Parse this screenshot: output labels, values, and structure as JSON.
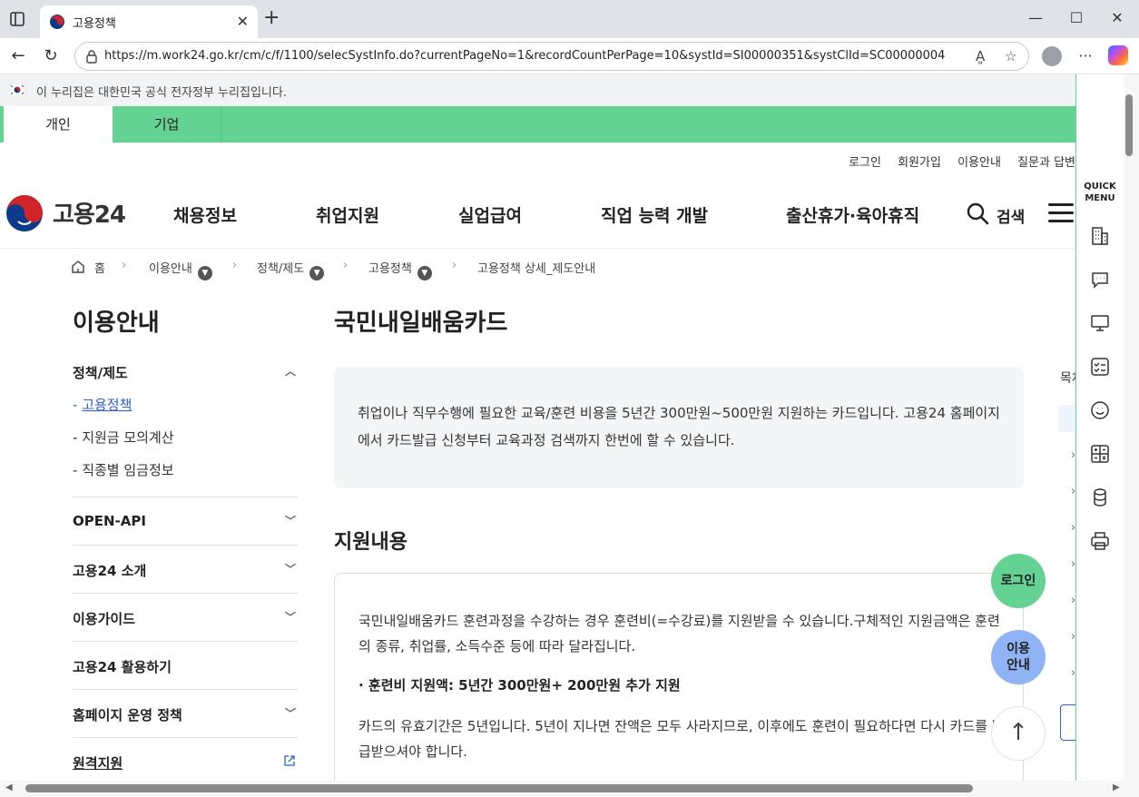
{
  "browser": {
    "tab_title": "고용정책",
    "url": "https://m.work24.go.kr/cm/c/f/1100/selecSystInfo.do?currentPageNo=1&recordCountPerPage=10&systId=SI00000351&systClId=SC00000004",
    "new_tab": "+",
    "minimize": "—",
    "maximize": "☐",
    "close": "✕"
  },
  "gov_banner": {
    "text": "이 누리집은 대한민국 공식 전자정부 누리집입니다."
  },
  "user_tabs": {
    "personal": "개인",
    "business": "기업"
  },
  "util_links": [
    "로그인",
    "회원가입",
    "이용안내",
    "질문과 답변"
  ],
  "logo": {
    "text": "고용24"
  },
  "gnb": [
    "채용정보",
    "취업지원",
    "실업급여",
    "직업 능력 개발",
    "출산휴가·육아휴직"
  ],
  "search_label": "검색",
  "breadcrumb": {
    "home": "홈",
    "level1": "이용안내",
    "level2": "정책/제도",
    "level3": "고용정책",
    "current": "고용정책 상세_제도안내"
  },
  "sidebar": {
    "title": "이용안내",
    "sections": [
      {
        "label": "정책/제도",
        "arrow": "︿"
      },
      {
        "label": "OPEN-API",
        "arrow": "﹀"
      },
      {
        "label": "고용24 소개",
        "arrow": "﹀"
      },
      {
        "label": "이용가이드",
        "arrow": "﹀"
      },
      {
        "label": "고용24 활용하기",
        "arrow": ""
      },
      {
        "label": "홈페이지 운영 정책",
        "arrow": "﹀"
      },
      {
        "label": "원격지원",
        "arrow": ""
      }
    ],
    "sub_items": [
      "고용정책",
      "지원금 모의계산",
      "직종별 임금정보"
    ]
  },
  "main": {
    "title": "국민내일배움카드",
    "intro": "취업이나 직무수행에 필요한 교육/훈련 비용을 5년간 300만원~500만원 지원하는 카드입니다. 고용24 홈페이지에서 카드발급 신청부터 교육과정 검색까지 한번에 할 수 있습니다.",
    "section_title": "지원내용",
    "detail_p1": "국민내일배움카드 훈련과정을 수강하는 경우 훈련비(=수강료)를 지원받을 수 있습니다.구체적인 지원금액은 훈련의 종류, 취업률, 소득수준 등에 따라 달라집니다.",
    "detail_strong": "· 훈련비 지원액: 5년간 300만원+ 200만원 추가 지원",
    "detail_p2": "카드의 유효기간은 5년입니다. 5년이 지나면 잔액은 모두 사라지므로, 이후에도 훈련이 필요하다면 다시 카드를 발급받으셔야 합니다."
  },
  "toc": {
    "title": "목차"
  },
  "float": {
    "login": "로그인",
    "guide_line1": "이용",
    "guide_line2": "안내",
    "top": "↑"
  },
  "quick_menu": {
    "title_line1": "QUICK",
    "title_line2": "MENU",
    "icons": [
      "building-icon",
      "chat-icon",
      "monitor-icon",
      "checklist-icon",
      "smile-icon",
      "calculator-icon",
      "coins-icon",
      "printer-icon"
    ]
  },
  "colors": {
    "brand_green": "#63d293",
    "link_blue": "#2c5fd4",
    "guide_blue": "#8fb3f5"
  }
}
